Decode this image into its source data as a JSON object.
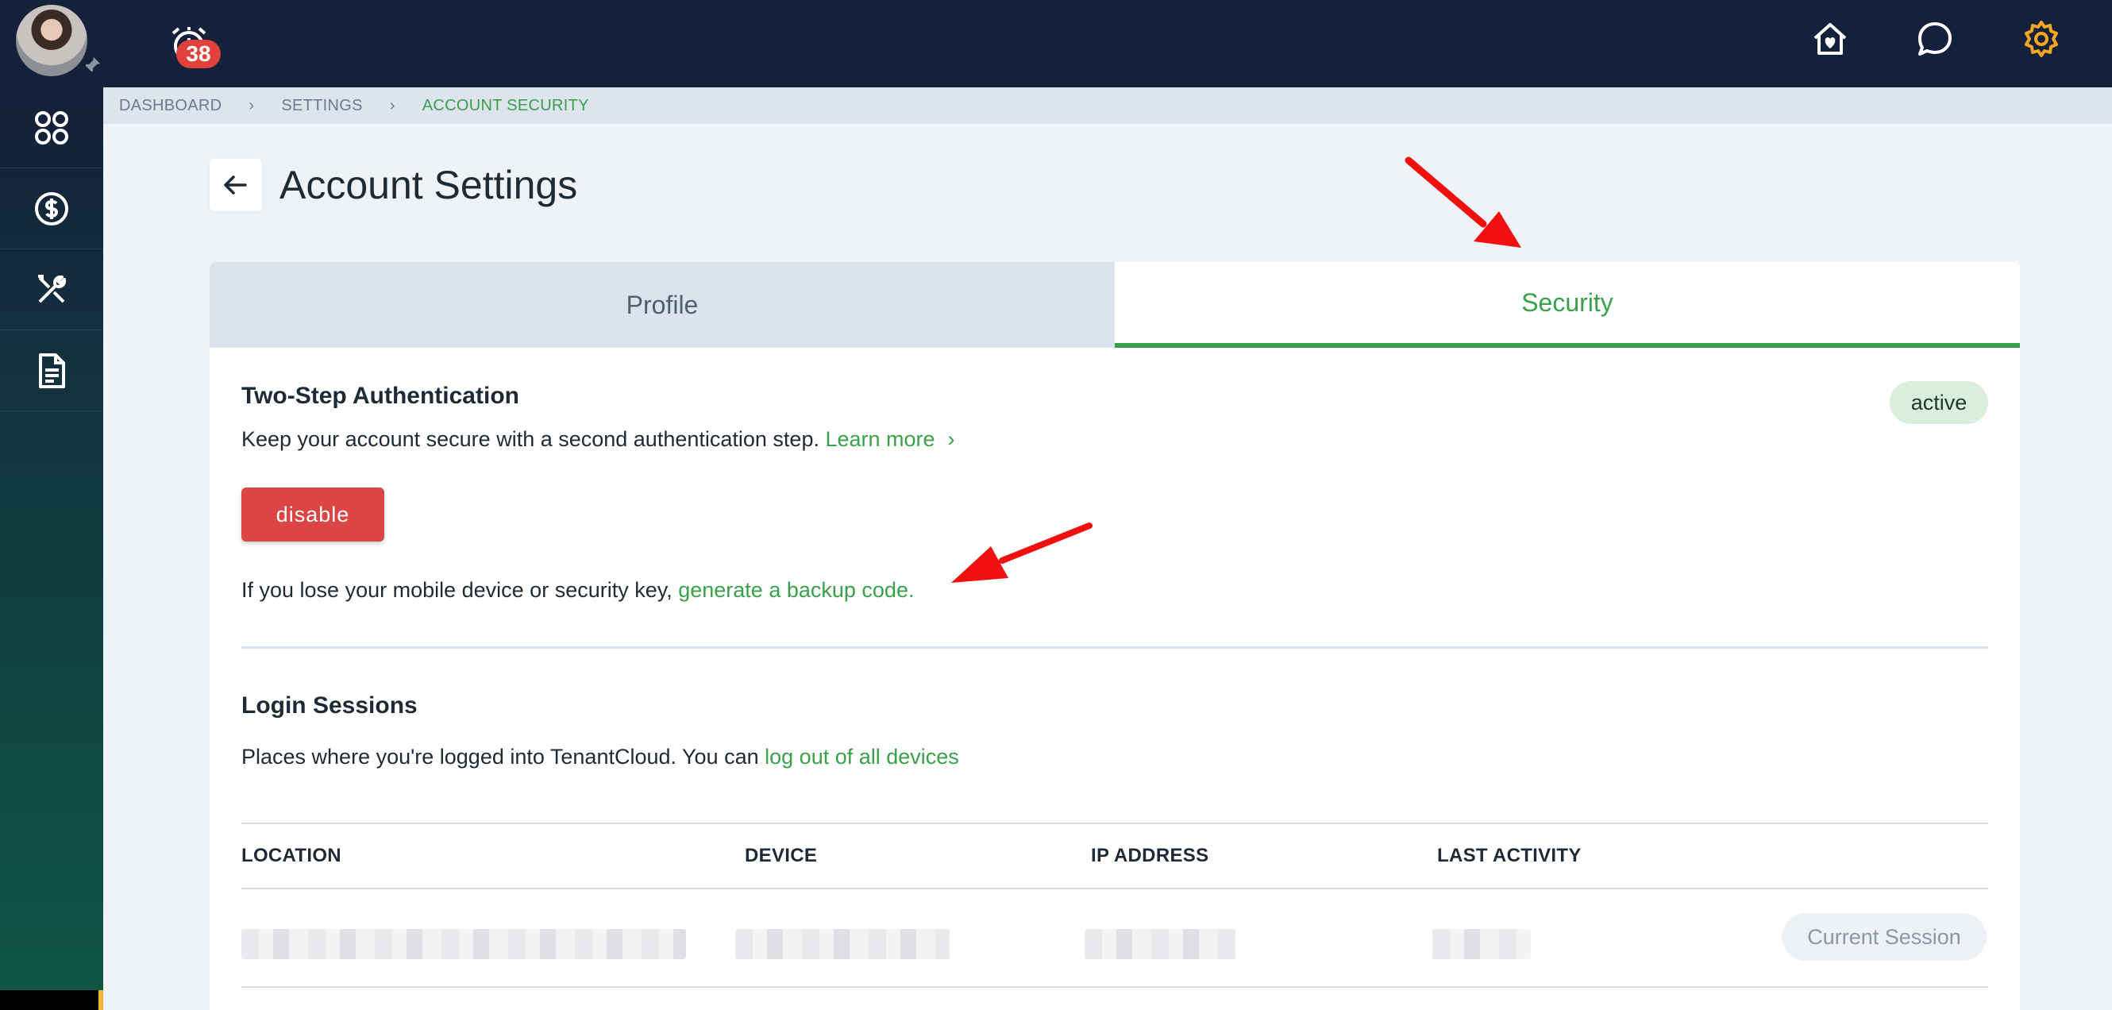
{
  "topbar": {
    "notification_count": "38",
    "icons": [
      "alarm-icon",
      "home-heart-icon",
      "chat-icon",
      "gear-icon"
    ],
    "accent_gear": "#f5a623"
  },
  "sidebar": {
    "items": [
      "apps-icon",
      "dollar-icon",
      "tools-icon",
      "document-icon"
    ]
  },
  "breadcrumb": [
    "DASHBOARD",
    "SETTINGS",
    "ACCOUNT SECURITY"
  ],
  "page": {
    "title": "Account Settings"
  },
  "tabs": [
    {
      "label": "Profile",
      "active": false
    },
    {
      "label": "Security",
      "active": true
    }
  ],
  "two_step": {
    "title": "Two-Step Authentication",
    "status": "active",
    "description": "Keep your account secure with a second authentication step. ",
    "learn_more": "Learn more",
    "disable_label": "disable",
    "backup_text": "If you lose your mobile device or security key, ",
    "backup_link": "generate a backup code."
  },
  "sessions": {
    "title": "Login Sessions",
    "description": "Places where you're logged into TenantCloud. You can ",
    "logout_link": "log out of all devices",
    "columns": [
      "LOCATION",
      "DEVICE",
      "IP ADDRESS",
      "LAST ACTIVITY"
    ],
    "rows": [
      {
        "status": "Current Session"
      }
    ]
  },
  "colors": {
    "brand_green": "#3aa04a",
    "danger_red": "#dc4545",
    "navy": "#15203a",
    "annotation_red": "#f01010"
  }
}
